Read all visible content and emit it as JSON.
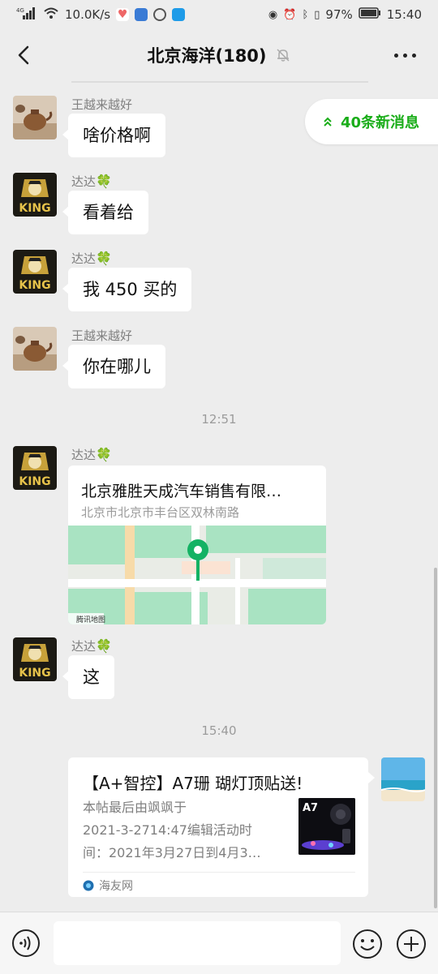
{
  "status_bar": {
    "network": "4G",
    "speed": "10.0K/s",
    "battery": "97%",
    "time": "15:40"
  },
  "header": {
    "title": "北京海洋(180)",
    "back_icon": "chevron-left-icon",
    "mute_icon": "bell-off-icon",
    "more_icon": "more-dots-icon"
  },
  "new_messages": {
    "label": "40条新消息",
    "icon": "double-chevron-up-icon",
    "color": "#1aad19"
  },
  "messages": [
    {
      "sender": "王越来越好",
      "text": "啥价格啊",
      "avatar": "teapot-avatar"
    },
    {
      "sender": "达达",
      "text": "看着给",
      "avatar": "king-avatar"
    },
    {
      "sender": "达达",
      "text": "我 450 买的",
      "avatar": "king-avatar"
    },
    {
      "sender": "王越来越好",
      "text": "你在哪儿",
      "avatar": "teapot-avatar"
    }
  ],
  "timestamps": [
    "12:51",
    "15:40"
  ],
  "location_message": {
    "sender": "达达",
    "name": "北京雅胜天成汽车销售有限…",
    "address": "北京市北京市丰台区双林南路",
    "map_source": "腾讯地图"
  },
  "short_message": {
    "sender": "达达",
    "text": "这"
  },
  "link_card": {
    "title": "【A+智控】A7珊 瑚灯顶贴送!",
    "desc_lines": [
      "本帖最后由飒飒于",
      "2021-3-2714:47编辑活动时",
      "间：2021年3月27日到4月3…"
    ],
    "thumb_label": "A7",
    "source": "海友网"
  },
  "input_bar": {
    "placeholder": "",
    "voice_icon": "voice-icon",
    "emoji_icon": "emoji-icon",
    "plus_icon": "plus-icon"
  }
}
